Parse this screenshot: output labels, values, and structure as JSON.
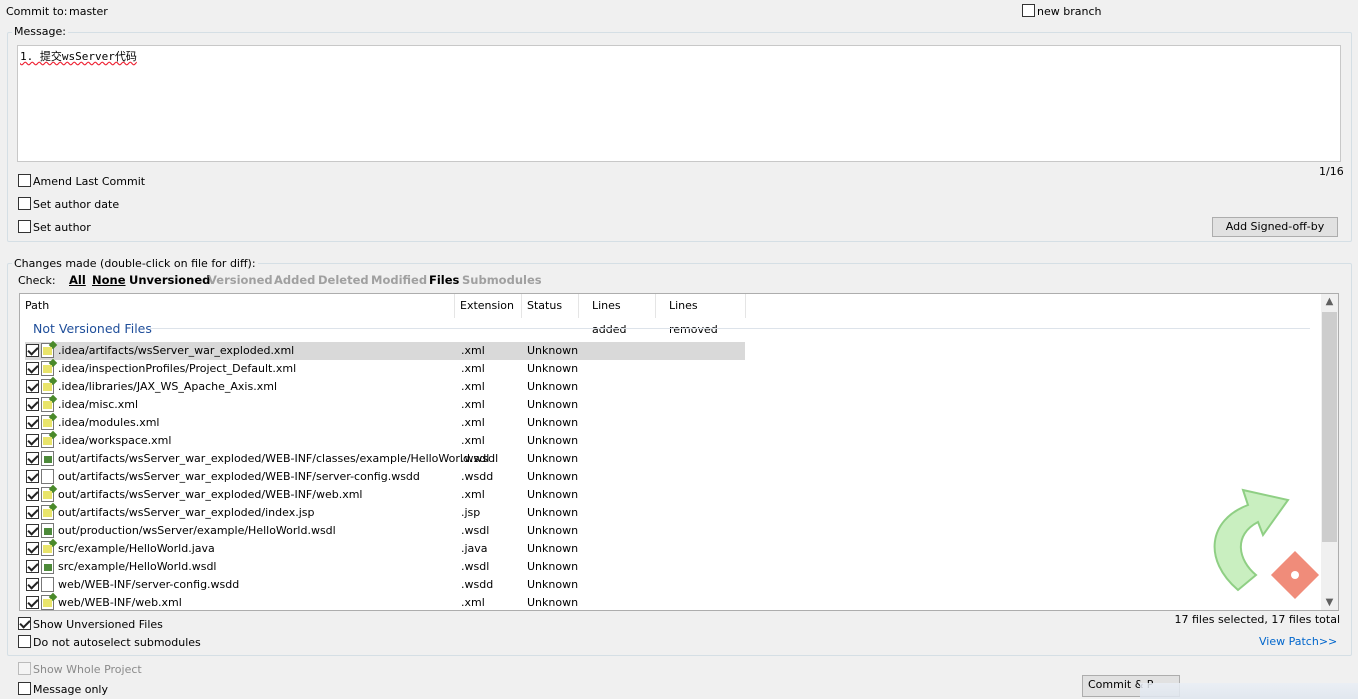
{
  "header": {
    "commit_to_label": "Commit to:",
    "branch": "master",
    "new_branch_label": "new branch"
  },
  "message": {
    "group_label": "Message:",
    "text": "1. 提交wsServer代码",
    "counter": "1/16"
  },
  "options": {
    "amend": "Amend Last Commit",
    "author_date": "Set author date",
    "author": "Set author",
    "signoff_button": "Add Signed-off-by"
  },
  "changes": {
    "group_label": "Changes made (double-click on file for diff):",
    "check_label": "Check:",
    "filters": [
      {
        "label": "All",
        "enabled": true
      },
      {
        "label": "None",
        "enabled": true
      },
      {
        "label": "Unversioned",
        "enabled": true
      },
      {
        "label": "Versioned",
        "enabled": false
      },
      {
        "label": "Added",
        "enabled": false
      },
      {
        "label": "Deleted",
        "enabled": false
      },
      {
        "label": "Modified",
        "enabled": false
      },
      {
        "label": "Files",
        "enabled": true
      },
      {
        "label": "Submodules",
        "enabled": false
      }
    ],
    "columns": [
      "Path",
      "Extension",
      "Status",
      "Lines added",
      "Lines removed"
    ],
    "section_title": "Not Versioned Files",
    "files": [
      {
        "path": ".idea/artifacts/wsServer_war_exploded.xml",
        "ext": ".xml",
        "status": "Unknown",
        "icon": "xml-file-icon"
      },
      {
        "path": ".idea/inspectionProfiles/Project_Default.xml",
        "ext": ".xml",
        "status": "Unknown",
        "icon": "xml-file-icon"
      },
      {
        "path": ".idea/libraries/JAX_WS_Apache_Axis.xml",
        "ext": ".xml",
        "status": "Unknown",
        "icon": "xml-file-icon"
      },
      {
        "path": ".idea/misc.xml",
        "ext": ".xml",
        "status": "Unknown",
        "icon": "xml-file-icon"
      },
      {
        "path": ".idea/modules.xml",
        "ext": ".xml",
        "status": "Unknown",
        "icon": "xml-file-icon"
      },
      {
        "path": ".idea/workspace.xml",
        "ext": ".xml",
        "status": "Unknown",
        "icon": "xml-file-icon"
      },
      {
        "path": "out/artifacts/wsServer_war_exploded/WEB-INF/classes/example/HelloWorld.wsdl",
        "ext": ".wsdl",
        "status": "Unknown",
        "icon": "wsdl-file-icon"
      },
      {
        "path": "out/artifacts/wsServer_war_exploded/WEB-INF/server-config.wsdd",
        "ext": ".wsdd",
        "status": "Unknown",
        "icon": "blank-file-icon"
      },
      {
        "path": "out/artifacts/wsServer_war_exploded/WEB-INF/web.xml",
        "ext": ".xml",
        "status": "Unknown",
        "icon": "xml-file-icon"
      },
      {
        "path": "out/artifacts/wsServer_war_exploded/index.jsp",
        "ext": ".jsp",
        "status": "Unknown",
        "icon": "xml-file-icon"
      },
      {
        "path": "out/production/wsServer/example/HelloWorld.wsdl",
        "ext": ".wsdl",
        "status": "Unknown",
        "icon": "wsdl-file-icon"
      },
      {
        "path": "src/example/HelloWorld.java",
        "ext": ".java",
        "status": "Unknown",
        "icon": "xml-file-icon"
      },
      {
        "path": "src/example/HelloWorld.wsdl",
        "ext": ".wsdl",
        "status": "Unknown",
        "icon": "wsdl-file-icon"
      },
      {
        "path": "web/WEB-INF/server-config.wsdd",
        "ext": ".wsdd",
        "status": "Unknown",
        "icon": "blank-file-icon"
      },
      {
        "path": "web/WEB-INF/web.xml",
        "ext": ".xml",
        "status": "Unknown",
        "icon": "xml-file-icon"
      }
    ],
    "show_unversioned": "Show Unversioned Files",
    "no_autoselect": "Do not autoselect submodules",
    "summary": "17 files selected, 17 files total",
    "view_patch": "View Patch>>"
  },
  "footer": {
    "show_whole_project": "Show Whole Project",
    "message_only": "Message only",
    "commit_button": "Commit & P"
  },
  "colors": {
    "link": "#0066cc",
    "section_title": "#1f4e9a",
    "selected_row": "#d9d9d9"
  }
}
